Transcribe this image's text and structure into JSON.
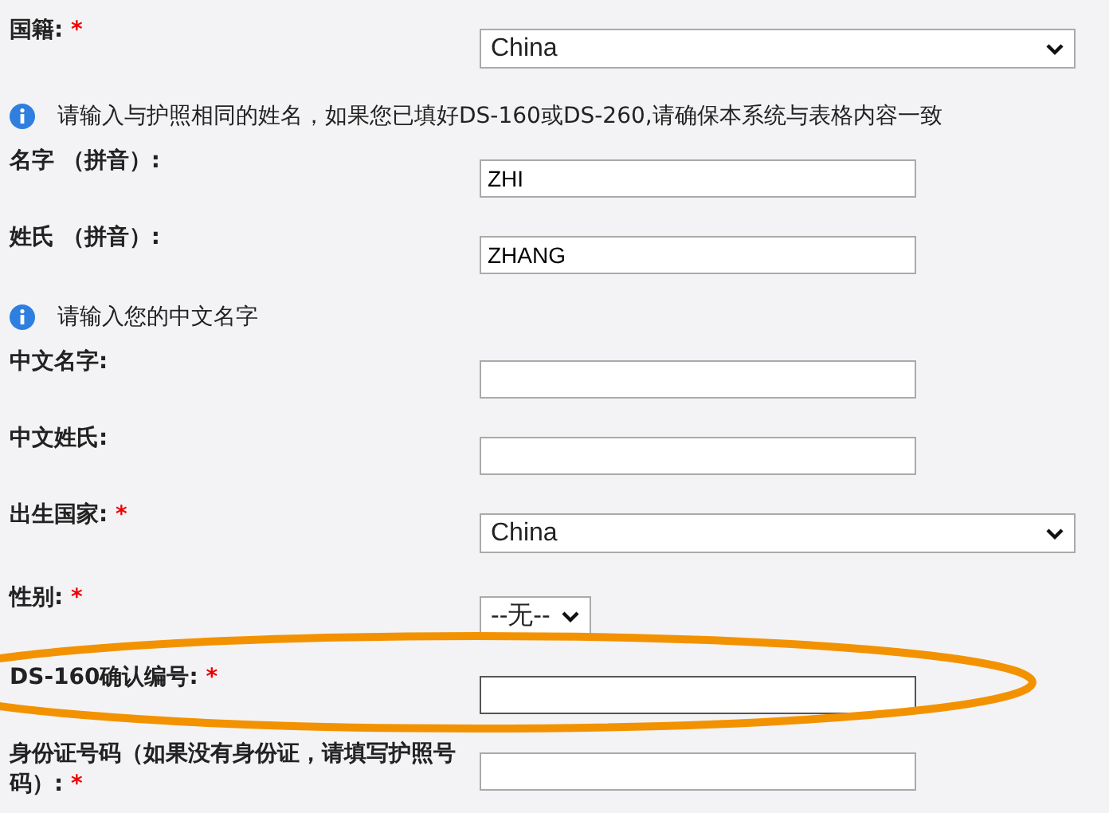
{
  "form": {
    "items": [
      {
        "kind": "select",
        "label": "国籍:",
        "required_mark": "*",
        "value": "China",
        "highlighted": false
      },
      {
        "kind": "info",
        "text": "请输入与护照相同的姓名，如果您已填好DS-160或DS-260,请确保本系统与表格内容一致"
      },
      {
        "kind": "text",
        "label": "名字 （拼音）:",
        "value": "ZHI",
        "highlighted": false
      },
      {
        "kind": "text",
        "label": "姓氏 （拼音）:",
        "value": "ZHANG",
        "highlighted": false
      },
      {
        "kind": "info",
        "text": "请输入您的中文名字"
      },
      {
        "kind": "text",
        "label": "中文名字:",
        "value": "",
        "highlighted": false
      },
      {
        "kind": "text",
        "label": "中文姓氏:",
        "value": "",
        "highlighted": false
      },
      {
        "kind": "select",
        "label": "出生国家:",
        "required_mark": "*",
        "value": "China",
        "highlighted": false
      },
      {
        "kind": "smallselect",
        "label": "性别:",
        "required_mark": "*",
        "value": "--无--",
        "highlighted": false
      },
      {
        "kind": "text",
        "label": "DS-160确认编号:",
        "required_mark": "*",
        "value": "",
        "highlighted": true
      },
      {
        "kind": "text",
        "label": "身份证号码（如果没有身份证，请填写护照号码）:",
        "required_mark": "*",
        "value": "",
        "highlighted": false
      }
    ]
  }
}
